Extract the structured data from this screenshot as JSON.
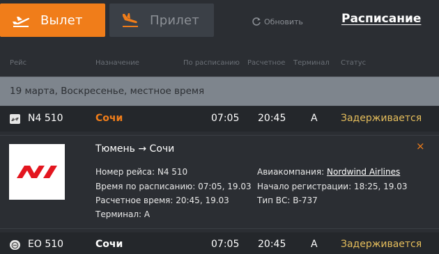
{
  "tabs": {
    "departure": {
      "label": "Вылет",
      "icon": "plane-takeoff-icon",
      "active": true
    },
    "arrival": {
      "label": "Прилет",
      "icon": "plane-landing-icon",
      "active": false
    }
  },
  "refresh": {
    "label": "Обновить",
    "icon": "refresh-icon"
  },
  "schedule_link": "Расписание",
  "columns": [
    "Рейс",
    "Назначение",
    "По расписанию",
    "Расчетное",
    "Терминал",
    "Статус"
  ],
  "date_header": "19 марта, Воскресенье, местное время",
  "flights": [
    {
      "flight": "N4 510",
      "destination": "Сочи",
      "scheduled": "07:05",
      "estimated": "20:45",
      "terminal": "A",
      "status": "Задерживается",
      "destination_color": "#f07d1a",
      "airline_icon": "nordwind-mini-logo-icon"
    },
    {
      "flight": "EO 510",
      "destination": "Сочи",
      "scheduled": "07:05",
      "estimated": "20:45",
      "terminal": "A",
      "status": "Задерживается",
      "destination_color": "#ffffff",
      "airline_icon": "airline-mini-logo-icon"
    }
  ],
  "detail": {
    "route": "Тюмень → Сочи",
    "flight_number": "Номер рейса: N4 510",
    "scheduled_time": "Время по расписанию: 07:05, 19.03",
    "estimated_time": "Расчетное время: 20:45, 19.03",
    "terminal": "Терминал: A",
    "airline_label": "Авиакомпания: ",
    "airline_name": "Nordwind Airlines",
    "checkin": "Начало регистрации: 18:25, 19.03",
    "aircraft": "Тип ВС: B-737",
    "logo_icon": "nordwind-logo-icon",
    "close_label": "×"
  },
  "colors": {
    "accent": "#f07d1a",
    "status": "#e7bf5c",
    "background": "#2b2e33",
    "row": "#24272b",
    "date_band": "#7e858d",
    "nordwind_red": "#e3161f"
  }
}
